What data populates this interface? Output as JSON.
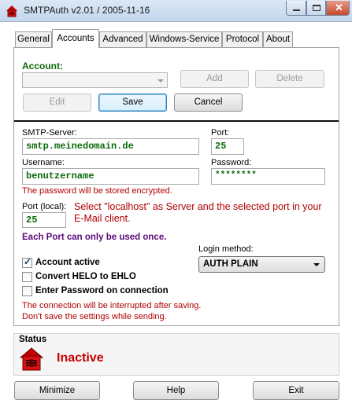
{
  "window": {
    "title": "SMTPAuth v2.01 / 2005-11-16",
    "colors": {
      "accent_green": "#0a6a0a",
      "warning_red": "#b00000",
      "inactive_red": "#c40000",
      "note_purple": "#5a0a7a"
    }
  },
  "tabs": [
    {
      "label": "General"
    },
    {
      "label": "Accounts",
      "active": true
    },
    {
      "label": "Advanced"
    },
    {
      "label": "Windows-Service"
    },
    {
      "label": "Protocol"
    },
    {
      "label": "About"
    }
  ],
  "account": {
    "label": "Account:",
    "selected": "",
    "buttons": {
      "add": "Add",
      "delete": "Delete",
      "edit": "Edit",
      "save": "Save",
      "cancel": "Cancel"
    }
  },
  "server": {
    "smtp_label": "SMTP-Server:",
    "smtp_value": "smtp.meinedomain.de",
    "port_label": "Port:",
    "port_value": "25",
    "username_label": "Username:",
    "username_value": "benutzername",
    "password_label": "Password:",
    "password_value": "********",
    "encrypted_note": "The password will be stored encrypted.",
    "local_port_label": "Port (local):",
    "local_port_value": "25",
    "localhost_hint": "Select \"localhost\" as Server and the selected port in your E-Mail client.",
    "each_port_note": "Each Port can only be used once."
  },
  "options": {
    "login_method_label": "Login method:",
    "login_method_value": "AUTH PLAIN",
    "account_active": {
      "label": "Account active",
      "checked": true
    },
    "convert_helo": {
      "label": "Convert HELO to EHLO",
      "checked": false
    },
    "enter_password": {
      "label": "Enter Password on connection",
      "checked": false
    },
    "note_line1": "The connection will be interrupted after saving.",
    "note_line2": "Don't save the settings while sending."
  },
  "status": {
    "heading": "Status",
    "state": "Inactive",
    "icon": "house-icon"
  },
  "bottom_buttons": {
    "minimize": "Minimize",
    "help": "Help",
    "exit": "Exit"
  }
}
